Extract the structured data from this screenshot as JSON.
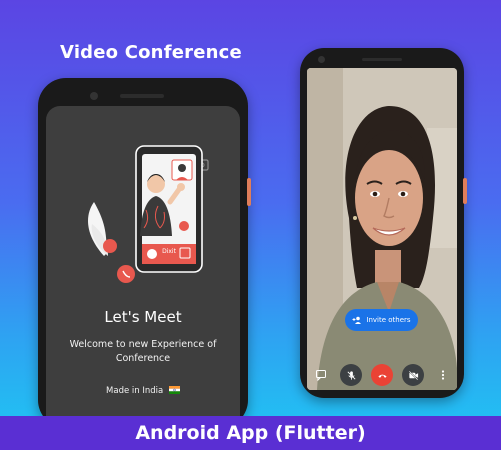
{
  "headline": "Video Conference",
  "welcome_screen": {
    "title": "Let's Meet",
    "subtitle": "Welcome to new Experience of Conference",
    "made_in": "Made in India",
    "illustration": {
      "caller_name": "Dixit"
    }
  },
  "call_screen": {
    "invite_label": "Invite others",
    "controls": [
      "chat-icon",
      "mic-off-icon",
      "end-call-icon",
      "video-off-icon",
      "more-icon"
    ]
  },
  "banner": "Android App (Flutter)",
  "colors": {
    "bg_top": "#5b45e3",
    "bg_bottom": "#1ec8f3",
    "banner": "#5a2fd3",
    "screen_dark": "#3e3e3e",
    "invite_blue": "#1a73e8",
    "end_call_red": "#ea4335",
    "accent_coral": "#e8584e"
  }
}
